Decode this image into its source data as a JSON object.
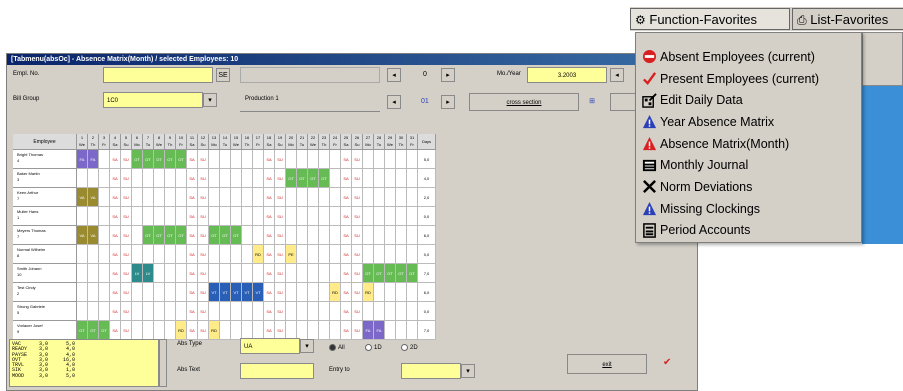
{
  "window": {
    "title": "[Tabmenu(absOc] - Absence Matrix(Month) / selected Employees: 10"
  },
  "form": {
    "empl_no_label": "Empl. No.",
    "empl_no_value": "",
    "search_btn": "SE",
    "empl_group_label": "Bill Group",
    "empl_group_value": "1C0",
    "production_label": "Production 1",
    "month_year_label": "Mo./Year",
    "month_year_value": "3.2003",
    "nav_mid_top": "0",
    "nav_mid_bottom": "01",
    "cross_section_btn": "cross section"
  },
  "grid": {
    "employee_header": "Employee",
    "days": [
      {
        "n": "1",
        "d": "We"
      },
      {
        "n": "2",
        "d": "Th"
      },
      {
        "n": "3",
        "d": "Fr"
      },
      {
        "n": "4",
        "d": "Sa"
      },
      {
        "n": "5",
        "d": "Su"
      },
      {
        "n": "6",
        "d": "Mo"
      },
      {
        "n": "7",
        "d": "Tu"
      },
      {
        "n": "8",
        "d": "We"
      },
      {
        "n": "9",
        "d": "Th"
      },
      {
        "n": "10",
        "d": "Fr"
      },
      {
        "n": "11",
        "d": "Sa"
      },
      {
        "n": "12",
        "d": "Su"
      },
      {
        "n": "13",
        "d": "Mo"
      },
      {
        "n": "14",
        "d": "Tu"
      },
      {
        "n": "15",
        "d": "We"
      },
      {
        "n": "16",
        "d": "Th"
      },
      {
        "n": "17",
        "d": "Fr"
      },
      {
        "n": "18",
        "d": "Sa"
      },
      {
        "n": "19",
        "d": "Su"
      },
      {
        "n": "20",
        "d": "Mo"
      },
      {
        "n": "21",
        "d": "Tu"
      },
      {
        "n": "22",
        "d": "We"
      },
      {
        "n": "23",
        "d": "Th"
      },
      {
        "n": "24",
        "d": "Fr"
      },
      {
        "n": "25",
        "d": "Sa"
      },
      {
        "n": "26",
        "d": "Su"
      },
      {
        "n": "27",
        "d": "Mo"
      },
      {
        "n": "28",
        "d": "Tu"
      },
      {
        "n": "29",
        "d": "We"
      },
      {
        "n": "30",
        "d": "Th"
      },
      {
        "n": "31",
        "d": "Fr"
      }
    ],
    "total_header": "Days",
    "rows": [
      {
        "name": "Bright Thomas",
        "id": "4",
        "total": "5,0",
        "cells": [
          "FA",
          "FA",
          "_",
          "SA",
          "SU",
          "OT",
          "OT",
          "OT",
          "OT",
          "OT",
          "SA",
          "SU",
          "_",
          "_",
          "_",
          "_",
          "_",
          "SA",
          "SU",
          "_",
          "_",
          "_",
          "_",
          "_",
          "SA",
          "SU",
          "_",
          "_",
          "_",
          "_",
          "_"
        ]
      },
      {
        "name": "Baker Martin",
        "id": "3",
        "total": "4,0",
        "cells": [
          "_",
          "_",
          "_",
          "SA",
          "SU",
          "_",
          "_",
          "_",
          "_",
          "_",
          "SA",
          "SU",
          "_",
          "_",
          "_",
          "_",
          "_",
          "SA",
          "SU",
          "OT",
          "OT",
          "OT",
          "OT",
          "_",
          "SA",
          "SU",
          "_",
          "_",
          "_",
          "_",
          "_"
        ]
      },
      {
        "name": "Keen Arthur",
        "id": "7",
        "total": "2,0",
        "cells": [
          "VA",
          "VA",
          "_",
          "SA",
          "SU",
          "_",
          "_",
          "_",
          "_",
          "_",
          "SA",
          "SU",
          "_",
          "_",
          "_",
          "_",
          "_",
          "SA",
          "SU",
          "_",
          "_",
          "_",
          "_",
          "_",
          "SA",
          "SU",
          "_",
          "_",
          "_",
          "_",
          "_"
        ]
      },
      {
        "name": "Muller Hans",
        "id": "1",
        "total": "0,0",
        "cells": [
          "_",
          "_",
          "_",
          "SA",
          "SU",
          "_",
          "_",
          "_",
          "_",
          "_",
          "SA",
          "SU",
          "_",
          "_",
          "_",
          "_",
          "_",
          "SA",
          "SU",
          "_",
          "_",
          "_",
          "_",
          "_",
          "SA",
          "SU",
          "_",
          "_",
          "_",
          "_",
          "_"
        ]
      },
      {
        "name": "Meyers Thomas",
        "id": "7",
        "total": "6,0",
        "cells": [
          "VA",
          "VA",
          "_",
          "SA",
          "SU",
          "_",
          "OT",
          "OT",
          "OT",
          "OT",
          "SA",
          "SU",
          "OT",
          "OT",
          "OT",
          "_",
          "_",
          "SA",
          "SU",
          "_",
          "_",
          "_",
          "_",
          "_",
          "SA",
          "SU",
          "_",
          "_",
          "_",
          "_",
          "_"
        ]
      },
      {
        "name": "Normal Wilhelm",
        "id": "8",
        "total": "0,0",
        "cells": [
          "_",
          "_",
          "_",
          "SA",
          "SU",
          "_",
          "_",
          "_",
          "_",
          "_",
          "SA",
          "SU",
          "_",
          "_",
          "_",
          "_",
          "RD",
          "SA",
          "SU",
          "PE",
          "_",
          "_",
          "_",
          "_",
          "SA",
          "SU",
          "_",
          "_",
          "_",
          "_",
          "_"
        ]
      },
      {
        "name": "Smith Johann",
        "id": "10",
        "total": "7,0",
        "cells": [
          "_",
          "_",
          "_",
          "SA",
          "SU",
          "LV",
          "LV",
          "_",
          "_",
          "_",
          "SA",
          "SU",
          "_",
          "_",
          "_",
          "_",
          "_",
          "SA",
          "SU",
          "_",
          "_",
          "_",
          "_",
          "_",
          "SA",
          "SU",
          "OT",
          "OT",
          "OT",
          "OT",
          "OT"
        ]
      },
      {
        "name": "Test Cindy",
        "id": "2",
        "total": "6,0",
        "cells": [
          "_",
          "_",
          "_",
          "SA",
          "SU",
          "_",
          "_",
          "_",
          "_",
          "_",
          "SA",
          "SU",
          "VT",
          "VT",
          "VT",
          "VT",
          "VT",
          "SA",
          "SU",
          "_",
          "_",
          "_",
          "_",
          "RD",
          "SA",
          "SU",
          "RD",
          "_",
          "_",
          "_",
          "_"
        ]
      },
      {
        "name": "Strong Gabriele",
        "id": "5",
        "total": "0,0",
        "cells": [
          "_",
          "_",
          "_",
          "SA",
          "SU",
          "_",
          "_",
          "_",
          "_",
          "_",
          "SA",
          "SU",
          "_",
          "_",
          "_",
          "_",
          "_",
          "SA",
          "SU",
          "_",
          "_",
          "_",
          "_",
          "_",
          "SA",
          "SU",
          "_",
          "_",
          "_",
          "_",
          "_"
        ]
      },
      {
        "name": "Vorlauer Josef",
        "id": "9",
        "total": "7,0",
        "cells": [
          "OT",
          "OT",
          "OT",
          "SA",
          "SU",
          "_",
          "_",
          "_",
          "_",
          "RD",
          "SA",
          "SU",
          "RD",
          "_",
          "_",
          "_",
          "_",
          "SA",
          "SU",
          "_",
          "_",
          "_",
          "_",
          "_",
          "SA",
          "SU",
          "FA",
          "FA",
          "_",
          "_",
          "_"
        ]
      }
    ]
  },
  "legend_box": {
    "lines": [
      "VAC      3,0      5,0",
      "READY    3,0      4,0",
      "PAYSE    3,0      4,0",
      "OVT      3,0     16,0",
      "TRVL     3,0      4,0",
      "SIK      3,0      1,0",
      "MOOD     3,0      5,0"
    ]
  },
  "bottom": {
    "abs_type_label": "Abs Type",
    "abs_type_value": "UA",
    "abs_text_label": "Abs Text",
    "radio_1": "All",
    "radio_2": "1D",
    "radio_3": "2D",
    "entry_label": "Entry to",
    "exit_btn": "exit",
    "check_mark": "✔"
  },
  "favorites": {
    "tab_function": "Function-Favorites",
    "tab_list": "List-Favorites",
    "items": [
      {
        "label": "Absent Employees (current)",
        "icon": "no-entry-icon",
        "color": "#d82020"
      },
      {
        "label": "Present Employees (current)",
        "icon": "checkmark-icon",
        "color": "#d82020"
      },
      {
        "label": "Edit Daily Data",
        "icon": "edit-data-icon",
        "color": "#000000"
      },
      {
        "label": "Year Absence Matrix",
        "icon": "blue-triangle-icon",
        "color": "#2a3fb8"
      },
      {
        "label": "Absence Matrix(Month)",
        "icon": "red-triangle-icon",
        "color": "#d82020"
      },
      {
        "label": "Monthly Journal",
        "icon": "journal-icon",
        "color": "#000000"
      },
      {
        "label": "Norm Deviations",
        "icon": "x-cross-icon",
        "color": "#000000"
      },
      {
        "label": "Missing Clockings",
        "icon": "blue-triangle-icon",
        "color": "#2a3fb8"
      },
      {
        "label": "Period Accounts",
        "icon": "accounts-icon",
        "color": "#000000"
      }
    ]
  }
}
